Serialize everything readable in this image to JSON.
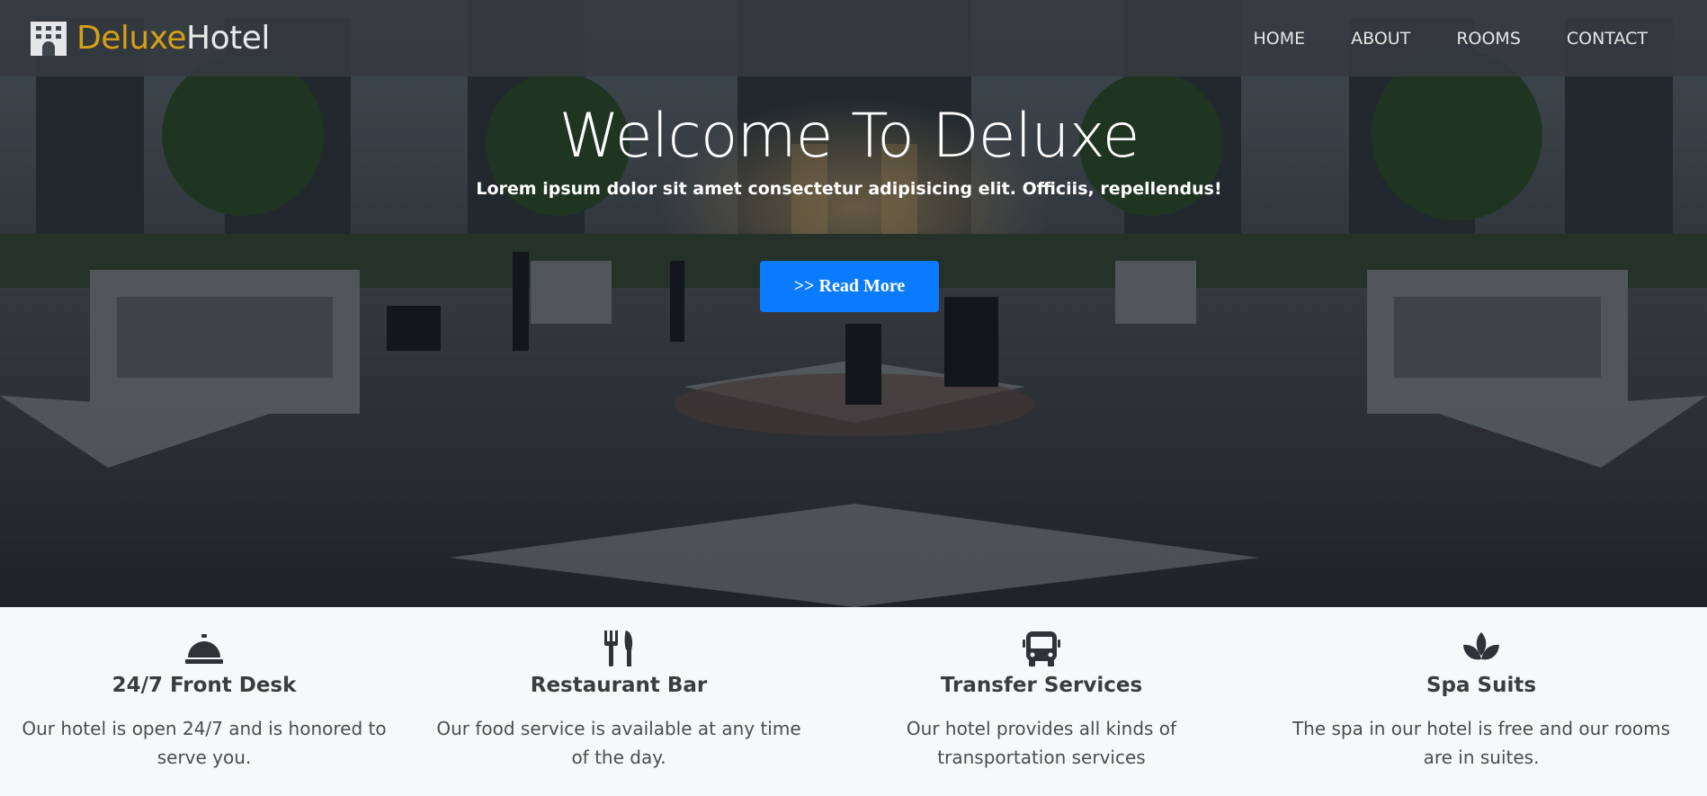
{
  "brand": {
    "part1": "Deluxe",
    "part2": "Hotel",
    "icon": "hotel-building-icon"
  },
  "nav": {
    "items": [
      {
        "label": "HOME"
      },
      {
        "label": "ABOUT"
      },
      {
        "label": "ROOMS"
      },
      {
        "label": "CONTACT"
      }
    ]
  },
  "hero": {
    "title": "Welcome To Deluxe",
    "subtitle": "Lorem ipsum dolor sit amet consectetur adipisicing elit. Officiis, repellendus!",
    "button_label": ">> Read More"
  },
  "features": [
    {
      "icon": "concierge-bell-icon",
      "title": "24/7 Front Desk",
      "text": "Our hotel is open 24/7 and is honored to serve you."
    },
    {
      "icon": "utensils-icon",
      "title": "Restaurant Bar",
      "text": "Our food service is available at any time of the day."
    },
    {
      "icon": "bus-icon",
      "title": "Transfer Services",
      "text": "Our hotel provides all kinds of transportation services"
    },
    {
      "icon": "spa-icon",
      "title": "Spa Suits",
      "text": "The spa in our hotel is free and our rooms are in suites."
    }
  ],
  "colors": {
    "brand_accent": "#d4a017",
    "nav_bg": "#343a40",
    "button": "#0a7bff",
    "feature_bg": "#f7f8f9",
    "text_dark": "#3a3d40"
  }
}
